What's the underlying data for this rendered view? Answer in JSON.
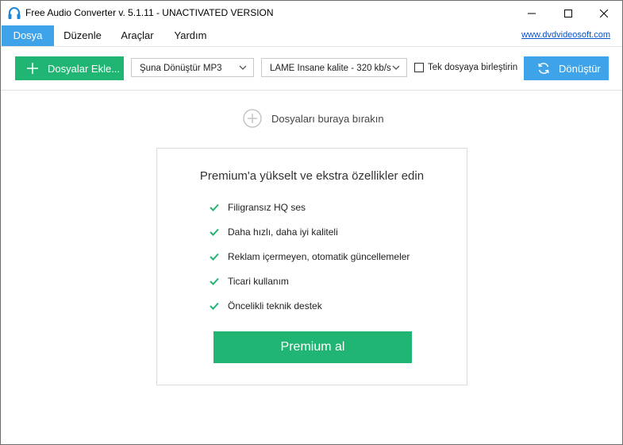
{
  "window": {
    "title": "Free Audio Converter v. 5.1.11 - UNACTIVATED VERSION"
  },
  "menu": {
    "items": [
      {
        "label": "Dosya"
      },
      {
        "label": "Düzenle"
      },
      {
        "label": "Araçlar"
      },
      {
        "label": "Yardım"
      }
    ],
    "link": "www.dvdvideosoft.com"
  },
  "toolbar": {
    "add_label": "Dosyalar Ekle...",
    "format_value": "Şuna Dönüştür MP3",
    "quality_value": "LAME Insane kalite - 320 kb/s",
    "merge_label": "Tek dosyaya birleştirin",
    "merge_checked": false,
    "convert_label": "Dönüştür"
  },
  "drop": {
    "hint": "Dosyaları buraya bırakın"
  },
  "premium": {
    "title": "Premium'a yükselt ve ekstra özellikler edin",
    "features": [
      "Filigransız HQ ses",
      "Daha hızlı, daha iyi kaliteli",
      "Reklam içermeyen, otomatik güncellemeler",
      "Ticari kullanım",
      "Öncelikli teknik destek"
    ],
    "button": "Premium al"
  },
  "colors": {
    "green": "#21b573",
    "blue": "#3ea3e8",
    "link": "#0a52c9"
  },
  "icons": [
    "headphones-icon",
    "minimize-icon",
    "maximize-icon",
    "close-icon",
    "plus-icon",
    "chevron-down-icon",
    "refresh-icon",
    "add-circle-icon",
    "check-icon"
  ]
}
